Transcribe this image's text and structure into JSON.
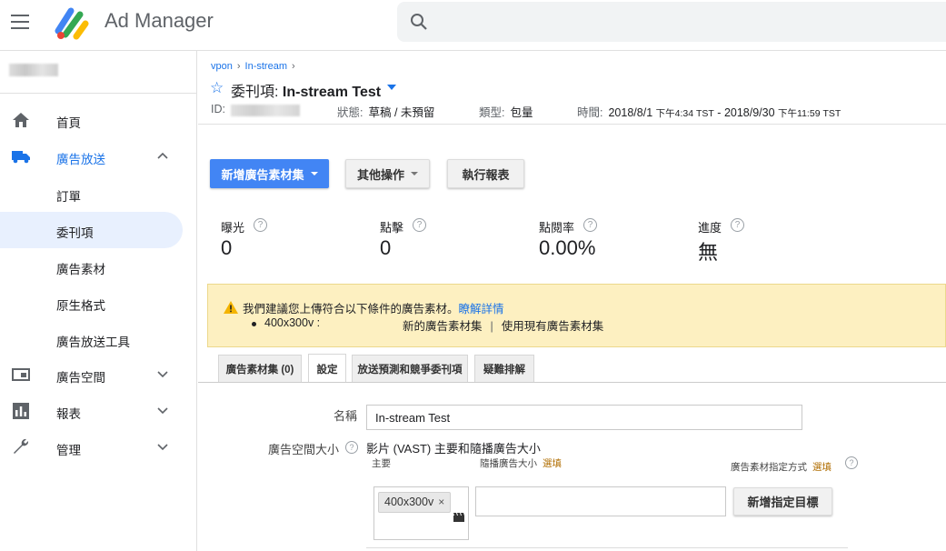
{
  "header": {
    "app_title": "Ad Manager",
    "search_placeholder": ""
  },
  "sidebar": {
    "items": [
      {
        "label": "首頁",
        "icon": "home-icon"
      },
      {
        "label": "廣告放送",
        "icon": "truck-icon",
        "expanded": true
      },
      {
        "label": "訂單"
      },
      {
        "label": "委刊項",
        "selected": true
      },
      {
        "label": "廣告素材"
      },
      {
        "label": "原生格式"
      },
      {
        "label": "廣告放送工具"
      },
      {
        "label": "廣告空間",
        "icon": "inventory-icon"
      },
      {
        "label": "報表",
        "icon": "bar-chart-icon"
      },
      {
        "label": "管理",
        "icon": "wrench-icon"
      }
    ]
  },
  "breadcrumb": [
    "vpon",
    "In-stream"
  ],
  "line_item": {
    "title_prefix": "委刊項: ",
    "title": "In-stream Test",
    "id_label": "ID:",
    "status_label": "狀態:",
    "status_value": "草稿 / 未預留",
    "type_label": "類型:",
    "type_value": "包量",
    "time_label": "時間:",
    "time_start": "2018/8/1",
    "time_start_small": "下午4:34 TST",
    "time_sep": " - ",
    "time_end": "2018/9/30",
    "time_end_small": "下午11:59 TST"
  },
  "actions": {
    "new_creative_set": "新增廣告素材集",
    "more_actions": "其他操作",
    "run_report": "執行報表"
  },
  "stats": [
    {
      "label": "曝光",
      "value": "0"
    },
    {
      "label": "點擊",
      "value": "0"
    },
    {
      "label": "點閱率",
      "value": "0.00%"
    },
    {
      "label": "進度",
      "value": "無"
    }
  ],
  "warning": {
    "text": "我們建議您上傳符合以下條件的廣告素材。",
    "learn_more": "瞭解詳情",
    "size": "400x300v :",
    "new_creative_set": "新的廣告素材集",
    "separator": "|",
    "use_existing": "使用現有廣告素材集",
    "color": "#fdf0c1"
  },
  "tabs": [
    {
      "label": "廣告素材集 (0)"
    },
    {
      "label": "設定",
      "active": true
    },
    {
      "label": "放送預測和競爭委刊項"
    },
    {
      "label": "疑難排解"
    }
  ],
  "settings": {
    "name_label": "名稱",
    "name_value": "In-stream Test",
    "inventory_size_label": "廣告空間大小",
    "inventory_size_value": "影片 (VAST) 主要和隨播廣告大小",
    "master_label": "主要",
    "companion_label": "隨播廣告大小",
    "optional": "選填",
    "creative_targeting_label": "廣告素材指定方式",
    "master_chip": "400x300v",
    "add_targeting_button": "新增指定目標"
  },
  "colors": {
    "accent": "#1a73e8",
    "primary_button": "#4285f4"
  }
}
